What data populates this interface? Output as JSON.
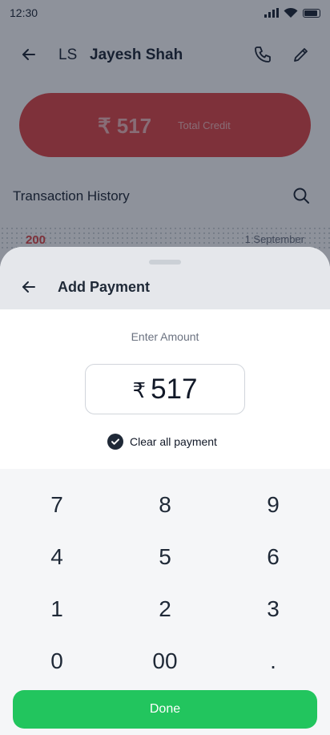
{
  "status_bar": {
    "time": "12:30"
  },
  "header": {
    "initials": "LS",
    "contact_name": "Jayesh Shah",
    "icons": [
      "back-arrow-icon",
      "phone-icon",
      "edit-icon"
    ]
  },
  "credit_card": {
    "amount": "₹ 517",
    "label": "Total Credit"
  },
  "history": {
    "title": "Transaction History",
    "rows": [
      {
        "amount": "200",
        "date": "1 September"
      }
    ]
  },
  "sheet": {
    "title": "Add Payment",
    "enter_label": "Enter Amount",
    "currency_symbol": "₹",
    "amount_value": "517",
    "clear_all": {
      "label": "Clear all payment",
      "checked": true
    }
  },
  "keypad": {
    "keys": [
      {
        "label": "7"
      },
      {
        "label": "8"
      },
      {
        "label": "9"
      },
      {
        "label": "4"
      },
      {
        "label": "5"
      },
      {
        "label": "6"
      },
      {
        "label": "1"
      },
      {
        "label": "2"
      },
      {
        "label": "3"
      },
      {
        "label": "0"
      },
      {
        "label": "00"
      },
      {
        "label": "."
      }
    ]
  },
  "done_button": {
    "label": "Done"
  },
  "colors": {
    "credit_red": "#e04848",
    "done_green": "#22c55e",
    "text_dark": "#1f2937",
    "muted_text": "#6b7280",
    "keypad_bg": "#f5f6f8"
  }
}
